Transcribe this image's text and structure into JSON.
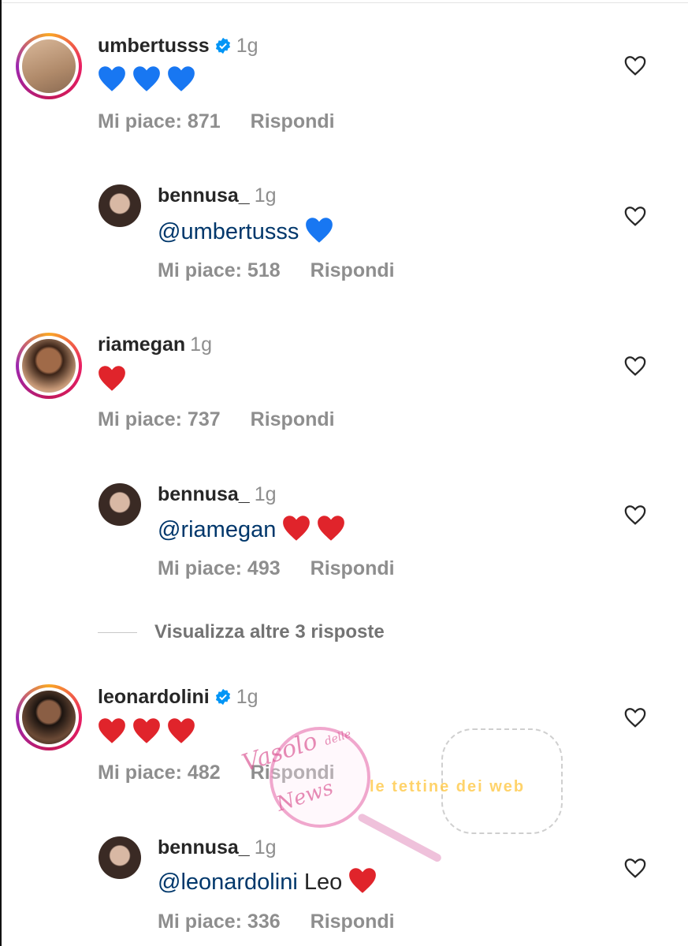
{
  "colors": {
    "text": "#262626",
    "secondary": "#8e8e8e",
    "mention": "#00376b",
    "verified": "#0095f6",
    "blue_heart": "#1877f2",
    "red_heart": "#e0242b"
  },
  "comments": [
    {
      "username": "umbertusss",
      "time": "1g",
      "verified": true,
      "hearts": [
        "blue-heart",
        "blue-heart",
        "blue-heart"
      ],
      "mention": "",
      "text": "",
      "likes": "Mi piace: 871",
      "reply": "Rispondi"
    },
    {
      "username": "bennusa_",
      "time": "1g",
      "verified": false,
      "hearts": [
        "blue-heart"
      ],
      "mention": "@umbertusss",
      "text": "",
      "likes": "Mi piace: 518",
      "reply": "Rispondi"
    },
    {
      "username": "riamegan",
      "time": "1g",
      "verified": false,
      "hearts": [
        "red-heart"
      ],
      "mention": "",
      "text": "",
      "likes": "Mi piace: 737",
      "reply": "Rispondi"
    },
    {
      "username": "bennusa_",
      "time": "1g",
      "verified": false,
      "hearts": [
        "red-heart",
        "red-heart"
      ],
      "mention": "@riamegan",
      "text": "",
      "likes": "Mi piace: 493",
      "reply": "Rispondi"
    },
    {
      "username": "leonardolini",
      "time": "1g",
      "verified": true,
      "hearts": [
        "red-heart",
        "red-heart",
        "red-heart"
      ],
      "mention": "",
      "text": "",
      "likes": "Mi piace: 482",
      "reply": "Rispondi"
    },
    {
      "username": "bennusa_",
      "time": "1g",
      "verified": false,
      "hearts": [
        "red-heart"
      ],
      "mention": "@leonardolini",
      "text": "Leo",
      "likes": "Mi piace: 336",
      "reply": "Rispondi"
    }
  ],
  "more_replies": "Visualizza altre 3 risposte",
  "watermark": {
    "line1": "Vasolo",
    "line2": "delle",
    "line3": "News",
    "banner": "le tettine dei web"
  }
}
